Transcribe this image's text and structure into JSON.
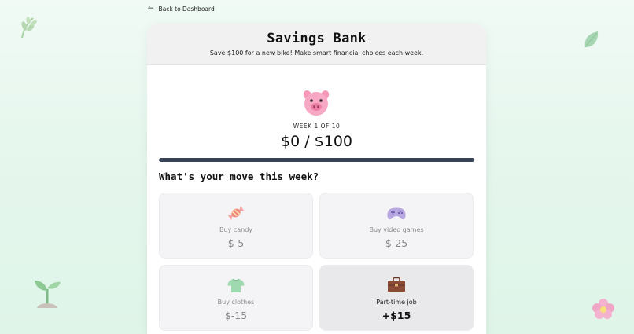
{
  "nav": {
    "back_label": "Back to Dashboard",
    "back_icon": "arrow-left-icon"
  },
  "header": {
    "title": "Savings Bank",
    "subtitle": "Save $100 for a new bike! Make smart financial choices each week."
  },
  "status": {
    "week_label": "WEEK 1 OF 10",
    "amount_text": "$0 / $100",
    "progress_fraction": 0
  },
  "prompt": {
    "heading": "What's your move this week?"
  },
  "choices": [
    {
      "icon": "candy-icon",
      "label": "Buy candy",
      "value": "$-5"
    },
    {
      "icon": "game-controller-icon",
      "label": "Buy video games",
      "value": "$-25"
    },
    {
      "icon": "shirt-icon",
      "label": "Buy clothes",
      "value": "$-15"
    },
    {
      "icon": "briefcase-icon",
      "label": "Part-time job",
      "value": "+$15"
    }
  ],
  "colors": {
    "progress_track": "#374357",
    "background": "#e6f7ee"
  }
}
